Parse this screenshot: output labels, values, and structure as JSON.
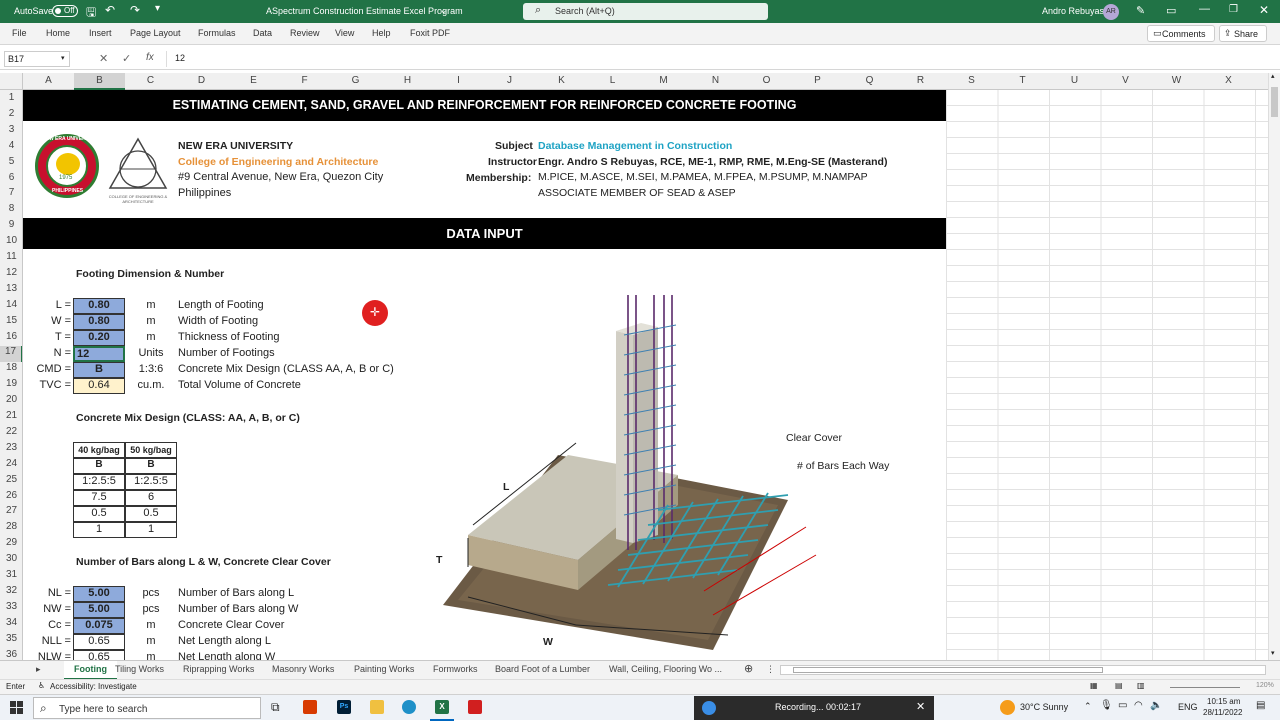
{
  "titlebar": {
    "autosave_label": "AutoSave",
    "autosave_state": "Off",
    "doc_title": "ASpectrum Construction Estimate Excel Program",
    "search_placeholder": "Search (Alt+Q)",
    "user_name": "Andro Rebuyas",
    "user_initials": "AR"
  },
  "menu": {
    "items": [
      "File",
      "Home",
      "Insert",
      "Page Layout",
      "Formulas",
      "Data",
      "Review",
      "View",
      "Help",
      "Foxit PDF"
    ],
    "comments": "Comments",
    "share": "Share"
  },
  "formula_bar": {
    "name_box": "B17",
    "fx": "fx",
    "value": "12"
  },
  "columns": [
    "A",
    "B",
    "C",
    "D",
    "E",
    "F",
    "G",
    "H",
    "I",
    "J",
    "K",
    "L",
    "M",
    "N",
    "O",
    "P",
    "Q",
    "R",
    "S",
    "T",
    "U",
    "V",
    "W",
    "X"
  ],
  "rows": [
    "1",
    "2",
    "3",
    "4",
    "5",
    "6",
    "7",
    "8",
    "9",
    "10",
    "11",
    "12",
    "13",
    "14",
    "15",
    "16",
    "17",
    "18",
    "19",
    "20",
    "21",
    "22",
    "23",
    "24",
    "25",
    "26",
    "27",
    "28",
    "29",
    "30",
    "31",
    "32",
    "33",
    "34",
    "35",
    "36"
  ],
  "sheet": {
    "main_title": "ESTIMATING CEMENT, SAND, GRAVEL AND REINFORCEMENT FOR REINFORCED CONCRETE FOOTING",
    "school": "NEW ERA UNIVERSITY",
    "college": "College of Engineering and Architecture",
    "address1": "#9 Central Avenue, New Era, Quezon City",
    "address2": "Philippines",
    "subject_label": "Subject",
    "subject": "Database Management in Construction",
    "instructor_label": "Instructor",
    "instructor": "Engr. Andro S Rebuyas, RCE, ME-1, RMP, RME, M.Eng-SE (Masterand)",
    "membership_label": "Membership:",
    "membership1": "M.PICE, M.ASCE, M.SEI, M.PAMEA, M.FPEA, M.PSUMP, M.NAMPAP",
    "membership2": "ASSOCIATE MEMBER OF SEAD & ASEP",
    "data_input": "DATA INPUT",
    "section1": "Footing Dimension & Number",
    "section2": "Concrete Mix Design  (CLASS: AA, A, B, or C)",
    "section3": "Number of Bars along L & W, Concrete Clear Cover",
    "logo1_text": "NEW ERA UNIVERSITY",
    "logo1_sub": "PHILIPPINES",
    "logo1_year": "1975",
    "logo2_text": "COLLEGE OF ENGINEERING & ARCHITECTURE"
  },
  "inputs1": [
    {
      "label": "L =",
      "value": "0.80",
      "unit": "m",
      "desc": "Length of Footing",
      "style": "blue"
    },
    {
      "label": "W =",
      "value": "0.80",
      "unit": "m",
      "desc": "Width of Footing",
      "style": "blue"
    },
    {
      "label": "T =",
      "value": "0.20",
      "unit": "m",
      "desc": "Thickness of Footing",
      "style": "blue"
    },
    {
      "label": "N =",
      "value": "12",
      "unit": "Units",
      "desc": "Number of Footings",
      "style": "blue"
    },
    {
      "label": "CMD =",
      "value": "B",
      "unit": "1:3:6",
      "desc": "Concrete Mix Design  (CLASS AA, A, B or C)",
      "style": "blue"
    },
    {
      "label": "TVC =",
      "value": "0.64",
      "unit": "cu.m.",
      "desc": "Total Volume of Concrete",
      "style": "yellow"
    }
  ],
  "mix_table": {
    "headers": [
      "40 kg/bag",
      "50 kg/bag"
    ],
    "rows": [
      [
        "B",
        "B"
      ],
      [
        "1:2.5:5",
        "1:2.5:5"
      ],
      [
        "7.5",
        "6"
      ],
      [
        "0.5",
        "0.5"
      ],
      [
        "1",
        "1"
      ]
    ]
  },
  "inputs2": [
    {
      "label": "NL =",
      "value": "5.00",
      "unit": "pcs",
      "desc": "Number of Bars along L",
      "style": "blue"
    },
    {
      "label": "NW =",
      "value": "5.00",
      "unit": "pcs",
      "desc": "Number of Bars along W",
      "style": "blue"
    },
    {
      "label": "Cc =",
      "value": "0.075",
      "unit": "m",
      "desc": "Concrete Clear Cover",
      "style": "blue"
    },
    {
      "label": "NLL =",
      "value": "0.65",
      "unit": "m",
      "desc": "Net Length along L",
      "style": "plain"
    },
    {
      "label": "NLW =",
      "value": "0.65",
      "unit": "m",
      "desc": "Net Length along W",
      "style": "plain"
    }
  ],
  "diagram": {
    "clear_cover": "Clear Cover",
    "bars_each_way": "# of Bars Each Way",
    "label_L": "L",
    "label_T": "T",
    "label_W": "W"
  },
  "tabs": [
    "Footing",
    "Tiling Works",
    "Riprapping Works",
    "Masonry Works",
    "Painting Works",
    "Formworks",
    "Board Foot of a Lumber",
    "Wall, Ceiling, Flooring Wo ..."
  ],
  "status": {
    "mode": "Enter",
    "accessibility": "Accessibility: Investigate",
    "zoom": "120%"
  },
  "taskbar": {
    "search_placeholder": "Type here to search",
    "recording": "Recording... 00:02:17",
    "weather": "30°C  Sunny",
    "lang": "ENG",
    "time": "10:15 am",
    "date": "28/11/2022"
  }
}
